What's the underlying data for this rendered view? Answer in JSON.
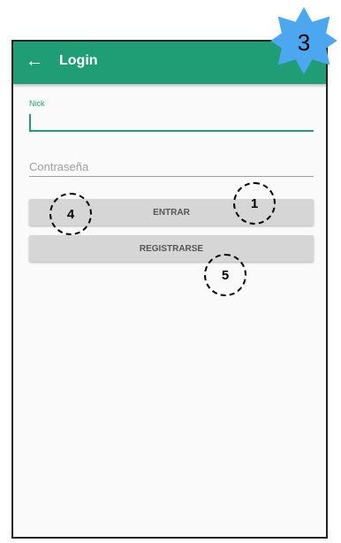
{
  "appbar": {
    "title": "Login",
    "back_icon": "arrow-left-icon",
    "color": "#1f9e76"
  },
  "form": {
    "nick_label": "Nick",
    "nick_value": "",
    "password_placeholder": "Contraseña",
    "password_value": ""
  },
  "buttons": {
    "entrar_label": "ENTRAR",
    "registrar_label": "REGISTRARSE"
  },
  "annotations": {
    "badge": "3",
    "markers": [
      "1",
      "4",
      "5"
    ]
  }
}
